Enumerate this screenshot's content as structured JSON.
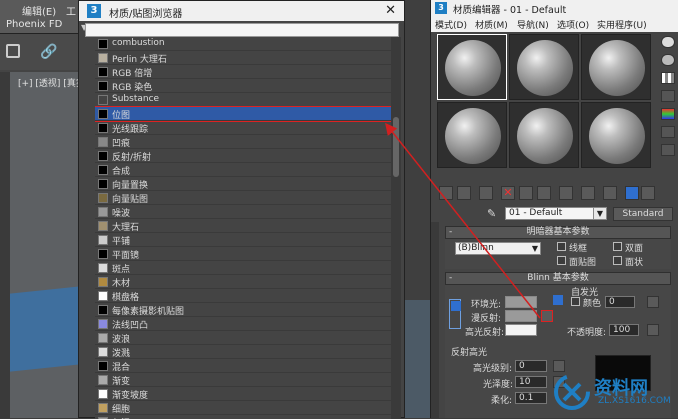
{
  "colors": {
    "accent_red": "#d22020",
    "selection_blue": "#2f5aa6",
    "brand_blue": "#1f7fc4"
  },
  "background_app": {
    "menu_items": [
      "编辑(E)",
      "工"
    ],
    "phoenix": "Phoenix FD",
    "viewport_label": "[+] [透视] [真实"
  },
  "browser": {
    "title": "材质/贴图浏览器",
    "close_icon": "close-icon",
    "items": [
      {
        "label": "combustion",
        "swatch": "#000000"
      },
      {
        "label": "Perlin 大理石",
        "swatch": "#b8b0a0"
      },
      {
        "label": "RGB 倍增",
        "swatch": "#000000"
      },
      {
        "label": "RGB 染色",
        "swatch": "#000000"
      },
      {
        "label": "Substance",
        "swatch": "#444444"
      },
      {
        "label": "位图",
        "swatch": "#000000",
        "selected": true
      },
      {
        "label": "光线跟踪",
        "swatch": "#000000"
      },
      {
        "label": "凹痕",
        "swatch": "#888888"
      },
      {
        "label": "反射/折射",
        "swatch": "#000000"
      },
      {
        "label": "合成",
        "swatch": "#000000"
      },
      {
        "label": "向量置换",
        "swatch": "#000000"
      },
      {
        "label": "向量贴图",
        "swatch": "#7a6a40"
      },
      {
        "label": "噪波",
        "swatch": "#999999"
      },
      {
        "label": "大理石",
        "swatch": "#a09070"
      },
      {
        "label": "平铺",
        "swatch": "#cccccc"
      },
      {
        "label": "平面镜",
        "swatch": "#000000"
      },
      {
        "label": "斑点",
        "swatch": "#dddddd"
      },
      {
        "label": "木材",
        "swatch": "#b08a40"
      },
      {
        "label": "棋盘格",
        "swatch": "#ffffff"
      },
      {
        "label": "每像素摄影机贴图",
        "swatch": "#000000"
      },
      {
        "label": "法线凹凸",
        "swatch": "#8a8ae0"
      },
      {
        "label": "波浪",
        "swatch": "#aaaaaa"
      },
      {
        "label": "泼溅",
        "swatch": "#dddddd"
      },
      {
        "label": "混合",
        "swatch": "#000000"
      },
      {
        "label": "渐变",
        "swatch": "#aaaaaa"
      },
      {
        "label": "渐变坡度",
        "swatch": "#ffffff"
      },
      {
        "label": "细胞",
        "swatch": "#c0a060"
      },
      {
        "label": "灰泥",
        "swatch": "#999999"
      }
    ]
  },
  "editor": {
    "title": "材质编辑器 - 01 - Default",
    "menu": [
      "模式(D)",
      "材质(M)",
      "导航(N)",
      "选项(O)",
      "实用程序(U)"
    ],
    "material_name": "01 - Default",
    "type_button": "Standard",
    "shader_rollout": {
      "title": "明暗器基本参数",
      "shader": "(B)Blinn",
      "checkboxes": [
        "线框",
        "双面",
        "面贴图",
        "面状"
      ]
    },
    "blinn_rollout": {
      "title": "Blinn 基本参数",
      "self_illum_title": "自发光",
      "color_label": "颜色",
      "self_illum_value": "0",
      "ambient_label": "环境光:",
      "diffuse_label": "漫反射:",
      "specular_label": "高光反射:",
      "opacity_label": "不透明度:",
      "opacity_value": "100"
    },
    "specular_group": {
      "title": "反射高光",
      "level_label": "高光级别:",
      "level_value": "0",
      "gloss_label": "光泽度:",
      "gloss_value": "10",
      "soften_label": "柔化:",
      "soften_value": "0.1"
    }
  },
  "watermark": {
    "text": "资料网",
    "url": "ZL.XS1616.COM"
  }
}
